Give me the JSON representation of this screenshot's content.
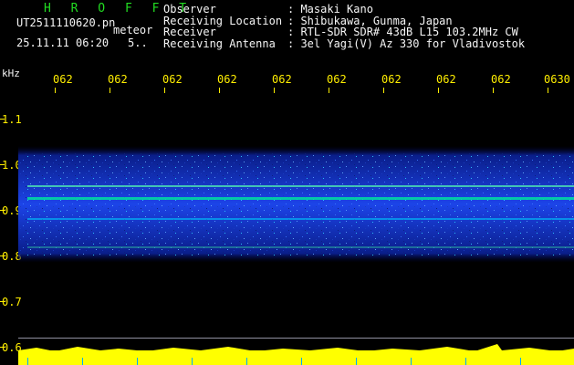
{
  "header": {
    "title": "H R O F F T",
    "filename": "UT2511110620.pn",
    "type_label": "meteor",
    "datetime": "25.11.11 06:20",
    "sub_value": "5..",
    "meta": [
      {
        "key": "Observer",
        "value": ": Masaki Kano"
      },
      {
        "key": "Receiving Location",
        "value": ": Shibukawa, Gunma, Japan"
      },
      {
        "key": "Receiver",
        "value": ": RTL-SDR SDR# 43dB L15 103.2MHz CW"
      },
      {
        "key": "Receiving Antenna",
        "value": ": 3el Yagi(V) Az 330 for Vladivostok"
      }
    ]
  },
  "axis": {
    "unit": "kHz",
    "x_ticks": [
      "062",
      "062",
      "062",
      "062",
      "062",
      "062",
      "062",
      "062",
      "062",
      "0630"
    ],
    "y_ticks": [
      "1.1",
      "1.0",
      "0.9",
      "0.8",
      "0.7",
      "0.6"
    ]
  },
  "colors": {
    "background": "#000000",
    "tick_text": "#ffee00",
    "title": "#22dd22",
    "signal_band": "#1e4bff",
    "signal_line": "#00e0a0",
    "baseline_bars": "#ffff00"
  }
}
